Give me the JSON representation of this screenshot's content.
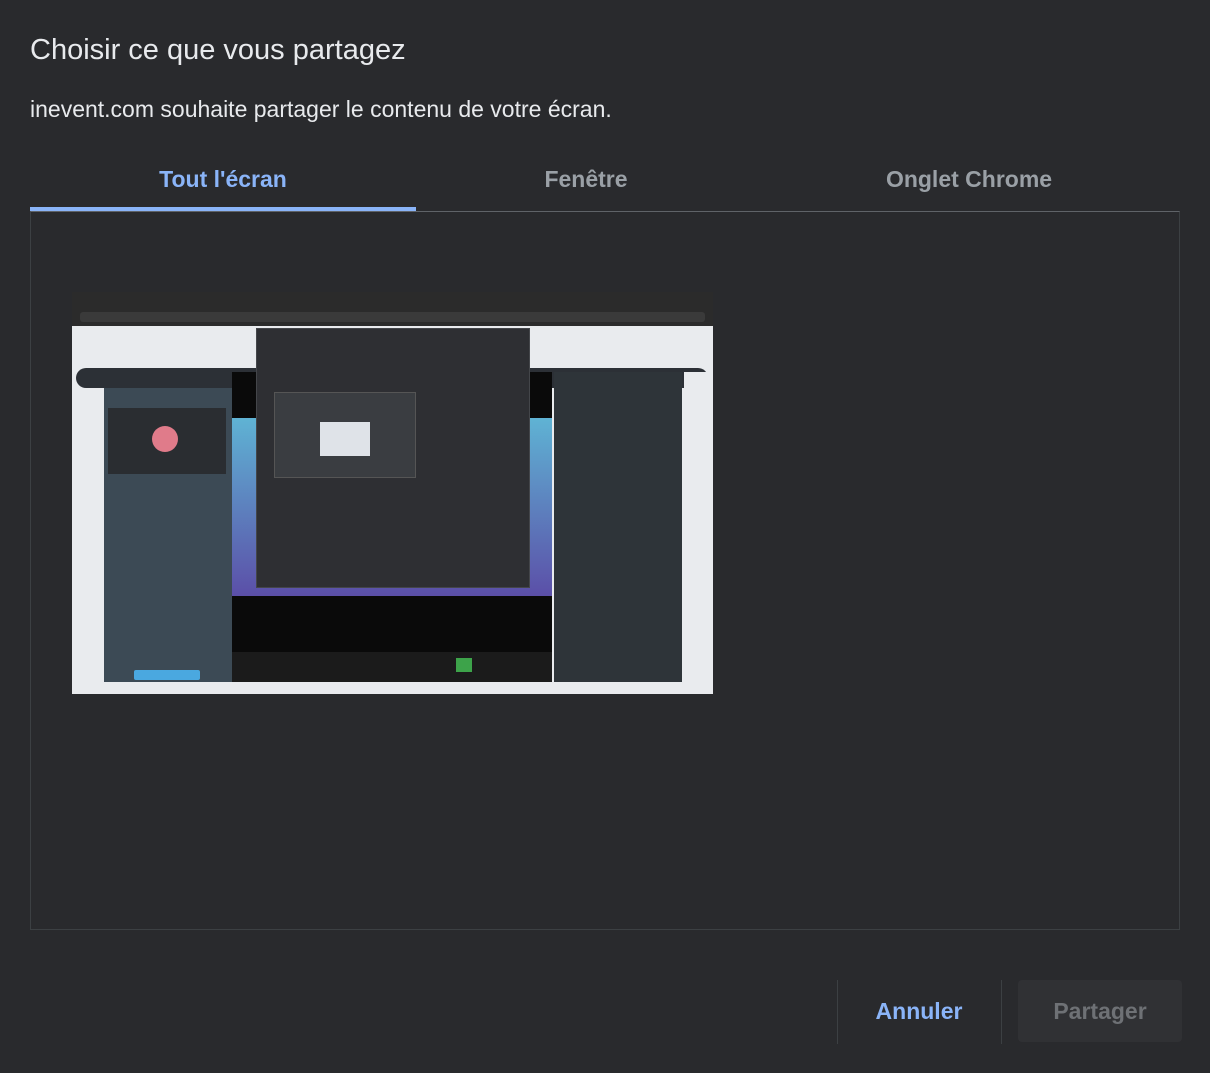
{
  "dialog": {
    "title": "Choisir ce que vous partagez",
    "subtitle": "inevent.com souhaite partager le contenu de votre écran."
  },
  "tabs": [
    {
      "label": "Tout l'écran",
      "selected": true
    },
    {
      "label": "Fenêtre",
      "selected": false
    },
    {
      "label": "Onglet Chrome",
      "selected": false
    }
  ],
  "buttons": {
    "cancel_label": "Annuler",
    "share_label": "Partager",
    "share_enabled": false
  },
  "colors": {
    "background": "#292a2d",
    "accent": "#8ab4f8",
    "text": "#e8eaed",
    "muted": "#9aa0a6"
  }
}
